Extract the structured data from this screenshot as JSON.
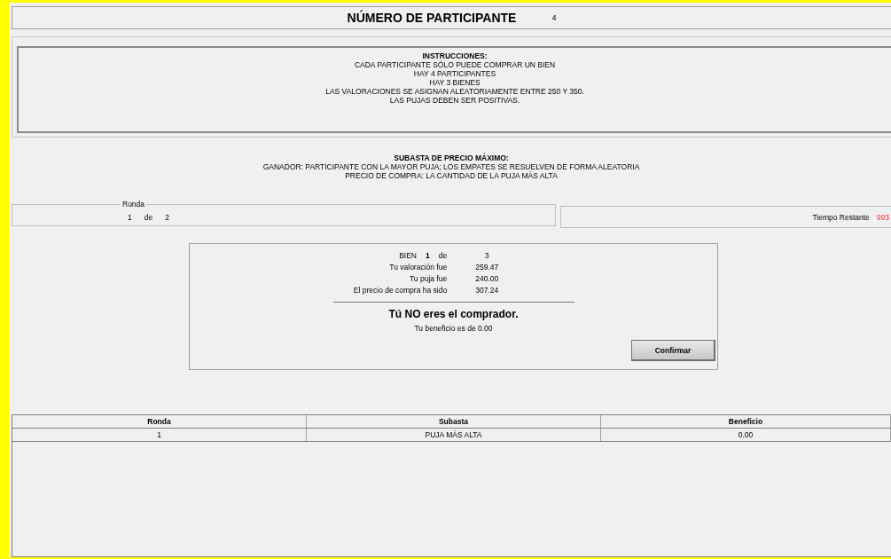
{
  "header": {
    "title": "NÚMERO DE PARTICIPANTE",
    "participant_number": "4"
  },
  "instructions": {
    "title": "INSTRUCCIONES:",
    "lines": [
      "CADA PARTICIPANTE SÓLO PUEDE COMPRAR UN BIEN",
      "HAY 4 PARTICIPANTES",
      "HAY 3 BIENES",
      "LAS VALORACIONES SE ASIGNAN ALEATORIAMENTE ENTRE 250 Y 350.",
      "LAS PUJAS DEBEN SER POSITIVAS."
    ]
  },
  "auction": {
    "title": "SUBASTA DE PRECIO MÁXIMO:",
    "lines": [
      "GANADOR: PARTICIPANTE CON LA MAYOR PUJA; LOS EMPATES SE RESUELVEN DE FORMA ALEATORIA",
      "PRECIO DE COMPRA: LA CANTIDAD DE LA PUJA MÁS ALTA"
    ]
  },
  "round": {
    "legend": "Ronda",
    "current": "1",
    "of": "de",
    "total": "2"
  },
  "timer": {
    "label": "Tiempo Restante",
    "value": "993"
  },
  "result": {
    "good_label": "BIEN",
    "good_current": "1",
    "good_of": "de",
    "good_total": "3",
    "rows": [
      {
        "label": "Tu valoración fue",
        "value": "259.47"
      },
      {
        "label": "Tu puja fue",
        "value": "240.00"
      },
      {
        "label": "El precio de compra ha sido",
        "value": "307.24"
      }
    ],
    "outcome": "Tú NO eres el comprador.",
    "profit": "Tu beneficio es de 0.00",
    "button": "Confirmar"
  },
  "table": {
    "columns": [
      "Ronda",
      "Subasta",
      "Beneficio"
    ],
    "rows": [
      [
        "1",
        "PUJA MÁS ALTA",
        "0.00"
      ]
    ]
  }
}
